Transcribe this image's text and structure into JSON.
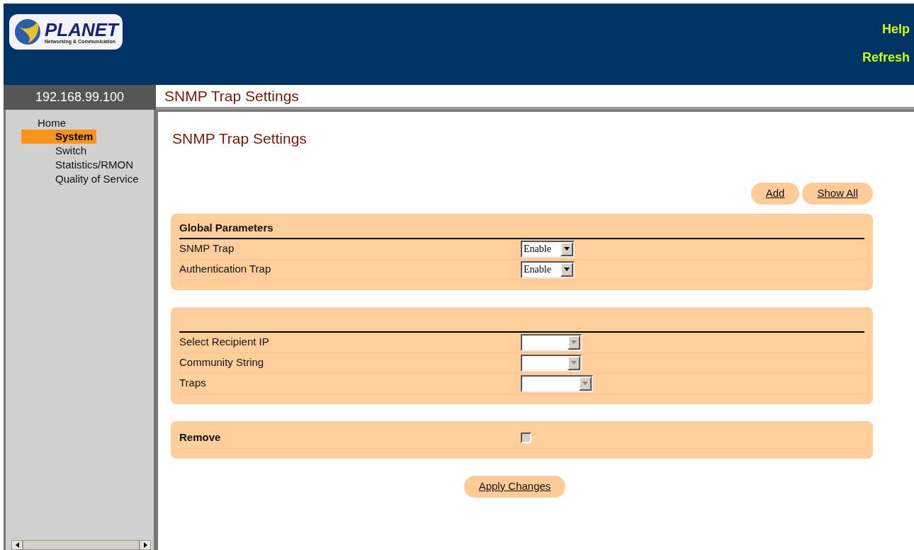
{
  "logo": {
    "name": "PLANET",
    "tagline": "Networking & Communication"
  },
  "header_links": [
    "Help",
    "Refresh"
  ],
  "device_ip": "192.168.99.100",
  "page_title": "SNMP Trap Settings",
  "sidebar": {
    "items": [
      {
        "label": "Home",
        "selected": false,
        "children": [
          {
            "label": "System",
            "selected": true
          },
          {
            "label": "Switch",
            "selected": false
          },
          {
            "label": "Statistics/RMON",
            "selected": false
          },
          {
            "label": "Quality of Service",
            "selected": false
          }
        ]
      }
    ]
  },
  "content_title": "SNMP Trap Settings",
  "top_buttons": [
    "Add",
    "Show All"
  ],
  "sections": [
    {
      "heading": "Global Parameters",
      "rows": [
        {
          "label": "SNMP Trap",
          "kind": "select",
          "value": "Enable"
        },
        {
          "label": "Authentication Trap",
          "kind": "select",
          "value": "Enable"
        }
      ]
    },
    {
      "rows": [
        {
          "label": "Select Recipient IP",
          "kind": "select",
          "disabled": true
        },
        {
          "label": "Community String",
          "kind": "select",
          "disabled": true
        },
        {
          "label": "Traps",
          "kind": "wideselect",
          "disabled": true
        }
      ]
    },
    {
      "rows": [
        {
          "label": "Remove",
          "kind": "checkbox",
          "checked": false
        }
      ]
    }
  ],
  "apply_button": "Apply Changes"
}
